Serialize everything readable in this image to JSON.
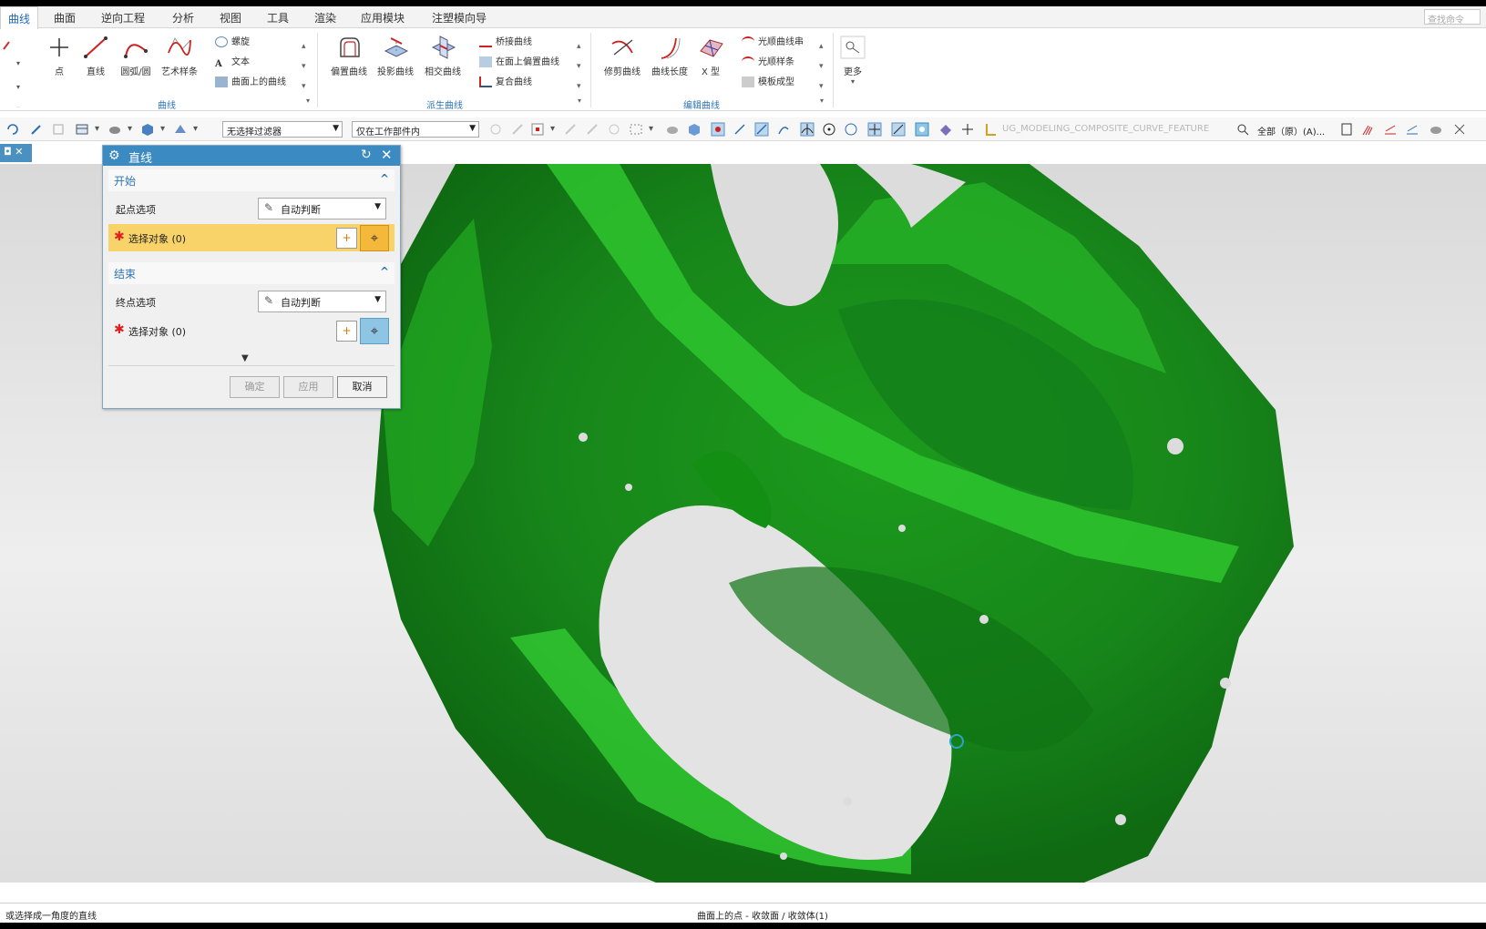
{
  "menu": {
    "items": [
      "曲线",
      "曲面",
      "逆向工程",
      "分析",
      "视图",
      "工具",
      "渲染",
      "应用模块",
      "注塑模向导"
    ],
    "active": "曲线",
    "search_placeholder": "查找命令"
  },
  "ribbon": {
    "curve_group": {
      "label": "曲线",
      "buttons": [
        "点",
        "直线",
        "圆弧/圆",
        "艺术样条"
      ],
      "small": [
        "螺旋",
        "文本",
        "曲面上的曲线"
      ]
    },
    "derived_group": {
      "label": "派生曲线",
      "buttons": [
        "偏置曲线",
        "投影曲线",
        "相交曲线"
      ],
      "small": [
        "桥接曲线",
        "在面上偏置曲线",
        "复合曲线"
      ]
    },
    "edit_group": {
      "label": "编辑曲线",
      "buttons": [
        "修剪曲线",
        "曲线长度",
        "X 型"
      ],
      "small": [
        "光顺曲线串",
        "光顺样条",
        "模板成型"
      ]
    },
    "more_label": "更多"
  },
  "toolbar": {
    "filter_combo": "无选择过滤器",
    "scope_combo": "仅在工作部件内",
    "feature_text": "UG_MODELING_COMPOSITE_CURVE_FEATURE",
    "layer_text": "全部（原）(A)..."
  },
  "dialog": {
    "title": "直线",
    "start_section": "开始",
    "start_option_label": "起点选项",
    "start_option_value": "自动判断",
    "start_select": "选择对象 (0)",
    "end_section": "结束",
    "end_option_label": "终点选项",
    "end_option_value": "自动判断",
    "end_select": "选择对象 (0)",
    "ok": "确定",
    "apply": "应用",
    "cancel": "取消"
  },
  "status": {
    "left": "或选择成一角度的直线",
    "center": "曲面上的点 - 收敛面 / 收敛体(1)"
  },
  "colors": {
    "accent": "#3b8ac2",
    "mesh_green": "#1fa81f",
    "active_row": "#f7d36a"
  }
}
